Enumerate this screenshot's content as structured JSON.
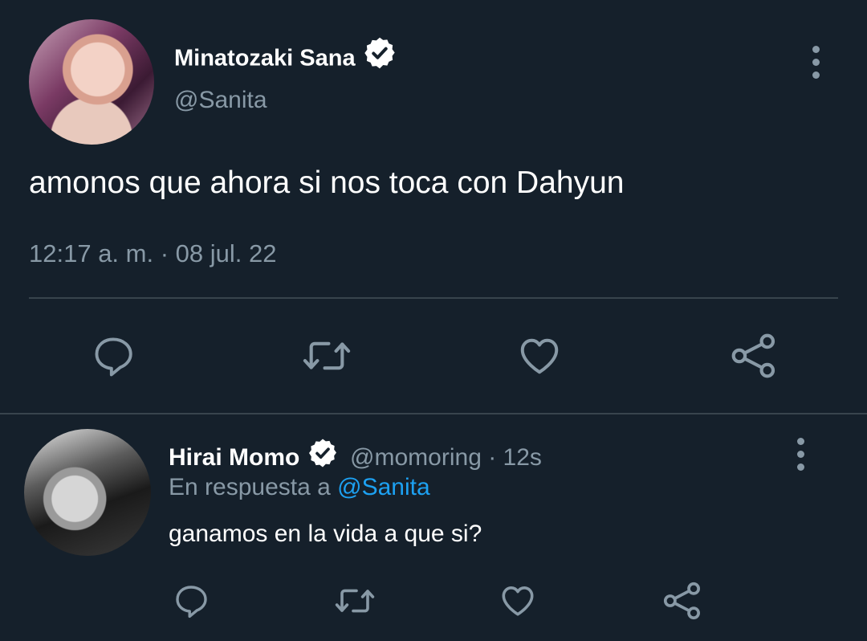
{
  "tweet": {
    "display_name": "Minatozaki Sana",
    "handle": "@Sanita",
    "text": "amonos que ahora si nos toca con Dahyun",
    "timestamp": "12:17 a. m. · 08 jul. 22",
    "actions": [
      "reply-icon",
      "retweet-icon",
      "like-icon",
      "share-icon"
    ]
  },
  "reply": {
    "display_name": "Hirai Momo",
    "handle": "@momoring",
    "time": "· 12s",
    "reply_prefix": "En respuesta a",
    "reply_to": "@Sanita",
    "text": "ganamos en la vida a que si?",
    "actions": [
      "reply-icon",
      "retweet-icon",
      "like-icon",
      "share-icon"
    ]
  },
  "colors": {
    "background": "#15202b",
    "muted": "#8899a6",
    "link": "#1da1f2",
    "divider": "#38444d"
  }
}
